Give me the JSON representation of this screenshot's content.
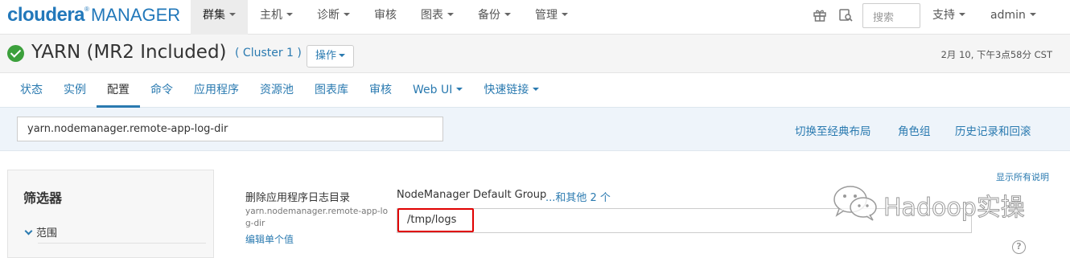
{
  "app": {
    "logo_brand": "cloudera",
    "logo_reg": "®",
    "logo_product": "MANAGER"
  },
  "topnav": [
    {
      "label": "群集",
      "dropdown": true,
      "active": true
    },
    {
      "label": "主机",
      "dropdown": true
    },
    {
      "label": "诊断",
      "dropdown": true
    },
    {
      "label": "审核",
      "dropdown": false
    },
    {
      "label": "图表",
      "dropdown": true
    },
    {
      "label": "备份",
      "dropdown": true
    },
    {
      "label": "管理",
      "dropdown": true
    }
  ],
  "top_right": {
    "icons": [
      "gift-icon",
      "task-search-icon"
    ],
    "search_placeholder": "搜索",
    "support_label": "支持",
    "user_label": "admin"
  },
  "service": {
    "status": "good-health",
    "status_color": "#3ca03c",
    "title": "YARN (MR2 Included)",
    "cluster": "( Cluster 1 )",
    "actions_label": "操作",
    "timestamp": "2月 10, 下午3点58分 CST"
  },
  "tabs": [
    {
      "label": "状态"
    },
    {
      "label": "实例"
    },
    {
      "label": "配置",
      "active": true
    },
    {
      "label": "命令"
    },
    {
      "label": "应用程序"
    },
    {
      "label": "资源池"
    },
    {
      "label": "图表库"
    },
    {
      "label": "审核"
    },
    {
      "label": "Web UI",
      "dropdown": true
    },
    {
      "label": "快速链接",
      "dropdown": true
    }
  ],
  "config_bar": {
    "search_value": "yarn.nodemanager.remote-app-log-dir",
    "links": [
      "切换至经典布局",
      "角色组",
      "历史记录和回滚"
    ]
  },
  "filters": {
    "title": "筛选器",
    "scope_label": "范围"
  },
  "config": {
    "show_all_desc": "显示所有说明",
    "property_label": "删除应用程序日志目录",
    "property_key": "yarn.nodemanager.remote-app-log-dir",
    "edit_single": "编辑单个值",
    "group_label": "NodeManager Default Group",
    "group_more": "...和其他 2 个",
    "value": "/tmp/logs",
    "help_symbol": "?"
  },
  "watermark": {
    "text": "Hadoop实操",
    "icon": "wechat-icon"
  },
  "colors": {
    "brand": "#2278ba",
    "link": "#2a7ab0",
    "highlight": "#e00000"
  }
}
